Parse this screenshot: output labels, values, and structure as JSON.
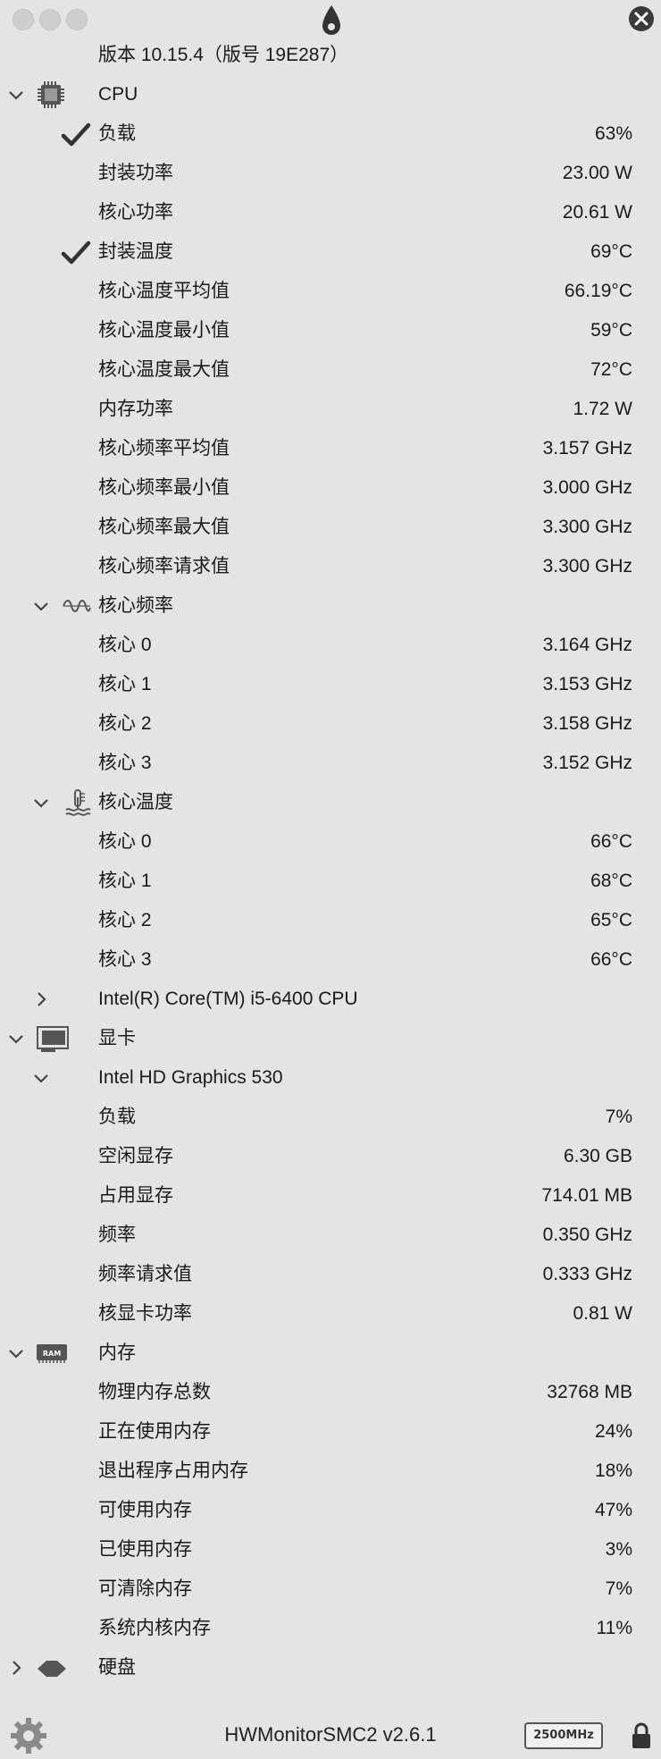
{
  "version": "版本 10.15.4（版号 19E287）",
  "sections": {
    "cpu": {
      "label": "CPU",
      "rows": [
        {
          "label": "负载",
          "value": "63%",
          "checked": true
        },
        {
          "label": "封装功率",
          "value": "23.00 W"
        },
        {
          "label": "核心功率",
          "value": "20.61 W"
        },
        {
          "label": "封装温度",
          "value": "69°C",
          "checked": true
        },
        {
          "label": "核心温度平均值",
          "value": "66.19°C"
        },
        {
          "label": "核心温度最小值",
          "value": "59°C"
        },
        {
          "label": "核心温度最大值",
          "value": "72°C"
        },
        {
          "label": "内存功率",
          "value": "1.72 W"
        },
        {
          "label": "核心频率平均值",
          "value": "3.157 GHz"
        },
        {
          "label": "核心频率最小值",
          "value": "3.000 GHz"
        },
        {
          "label": "核心频率最大值",
          "value": "3.300 GHz"
        },
        {
          "label": "核心频率请求值",
          "value": "3.300 GHz"
        }
      ],
      "core_freq": {
        "label": "核心频率",
        "rows": [
          {
            "label": "核心 0",
            "value": "3.164 GHz"
          },
          {
            "label": "核心 1",
            "value": "3.153 GHz"
          },
          {
            "label": "核心 2",
            "value": "3.158 GHz"
          },
          {
            "label": "核心 3",
            "value": "3.152 GHz"
          }
        ]
      },
      "core_temp": {
        "label": "核心温度",
        "rows": [
          {
            "label": "核心 0",
            "value": "66°C"
          },
          {
            "label": "核心 1",
            "value": "68°C"
          },
          {
            "label": "核心 2",
            "value": "65°C"
          },
          {
            "label": "核心 3",
            "value": "66°C"
          }
        ]
      },
      "model": "Intel(R) Core(TM) i5-6400 CPU"
    },
    "gpu": {
      "label": "显卡",
      "model": "Intel HD Graphics 530",
      "rows": [
        {
          "label": "负载",
          "value": "7%"
        },
        {
          "label": "空闲显存",
          "value": "6.30 GB"
        },
        {
          "label": "占用显存",
          "value": "714.01 MB"
        },
        {
          "label": "频率",
          "value": "0.350 GHz"
        },
        {
          "label": "频率请求值",
          "value": "0.333 GHz"
        },
        {
          "label": "核显卡功率",
          "value": "0.81 W"
        }
      ]
    },
    "memory": {
      "label": "内存",
      "icon_text": "RAM",
      "rows": [
        {
          "label": "物理内存总数",
          "value": "32768 MB"
        },
        {
          "label": "正在使用内存",
          "value": "24%"
        },
        {
          "label": "退出程序占用内存",
          "value": "18%"
        },
        {
          "label": "可使用内存",
          "value": "47%"
        },
        {
          "label": "已使用内存",
          "value": "3%"
        },
        {
          "label": "可清除内存",
          "value": "7%"
        },
        {
          "label": "系统内核内存",
          "value": "11%"
        }
      ]
    },
    "disk": {
      "label": "硬盘"
    }
  },
  "footer": {
    "app_title": "HWMonitorSMC2 v2.6.1",
    "freq_badge": "2500MHz"
  },
  "icons": {
    "titlebar": [
      "window-close-dot",
      "window-minimize-dot",
      "window-zoom-dot",
      "drop-icon",
      "close-icon"
    ],
    "sections": [
      "cpu-chip-icon",
      "wave-icon",
      "thermometer-icon",
      "gpu-card-icon",
      "ram-icon",
      "disk-icon"
    ],
    "footer": [
      "gear-icon",
      "lock-icon"
    ]
  }
}
